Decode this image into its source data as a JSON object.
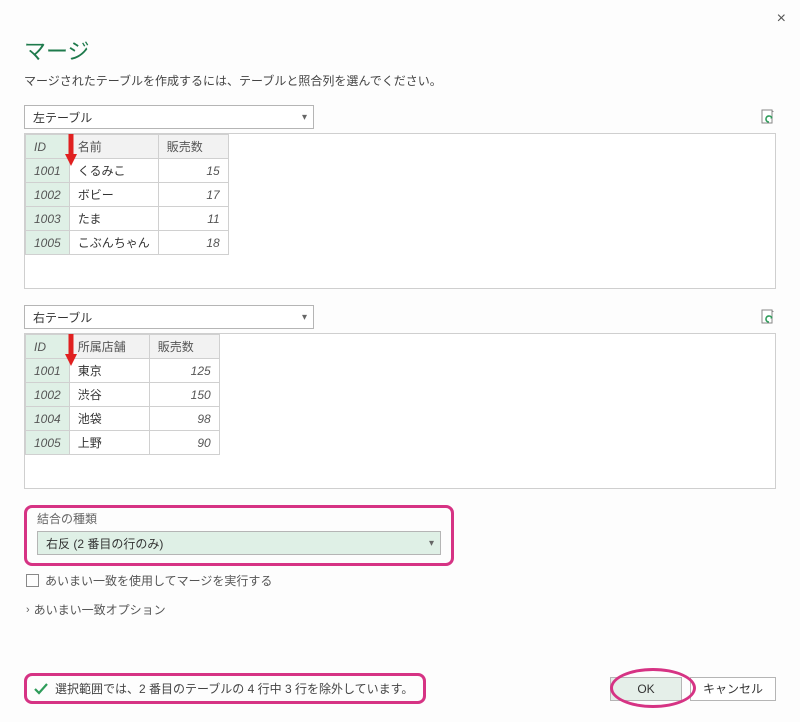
{
  "title": "マージ",
  "subtitle": "マージされたテーブルを作成するには、テーブルと照合列を選んでください。",
  "close_label": "×",
  "left_table": {
    "select_label": "左テーブル",
    "columns": [
      "ID",
      "名前",
      "販売数"
    ],
    "rows": [
      {
        "id": "1001",
        "name": "くるみこ",
        "num": "15"
      },
      {
        "id": "1002",
        "name": "ボビー",
        "num": "17"
      },
      {
        "id": "1003",
        "name": "たま",
        "num": "11"
      },
      {
        "id": "1005",
        "name": "こぶんちゃん",
        "num": "18"
      }
    ]
  },
  "right_table": {
    "select_label": "右テーブル",
    "columns": [
      "ID",
      "所属店舗",
      "販売数"
    ],
    "rows": [
      {
        "id": "1001",
        "name": "東京",
        "num": "125"
      },
      {
        "id": "1002",
        "name": "渋谷",
        "num": "150"
      },
      {
        "id": "1004",
        "name": "池袋",
        "num": "98"
      },
      {
        "id": "1005",
        "name": "上野",
        "num": "90"
      }
    ]
  },
  "join": {
    "label": "結合の種類",
    "value": "右反 (2 番目の行のみ)"
  },
  "fuzzy": {
    "checkbox_label": "あいまい一致を使用してマージを実行する",
    "options_label": "あいまい一致オプション"
  },
  "status": "選択範囲では、2 番目のテーブルの 4 行中 3 行を除外しています。",
  "buttons": {
    "ok": "OK",
    "cancel": "キャンセル"
  }
}
